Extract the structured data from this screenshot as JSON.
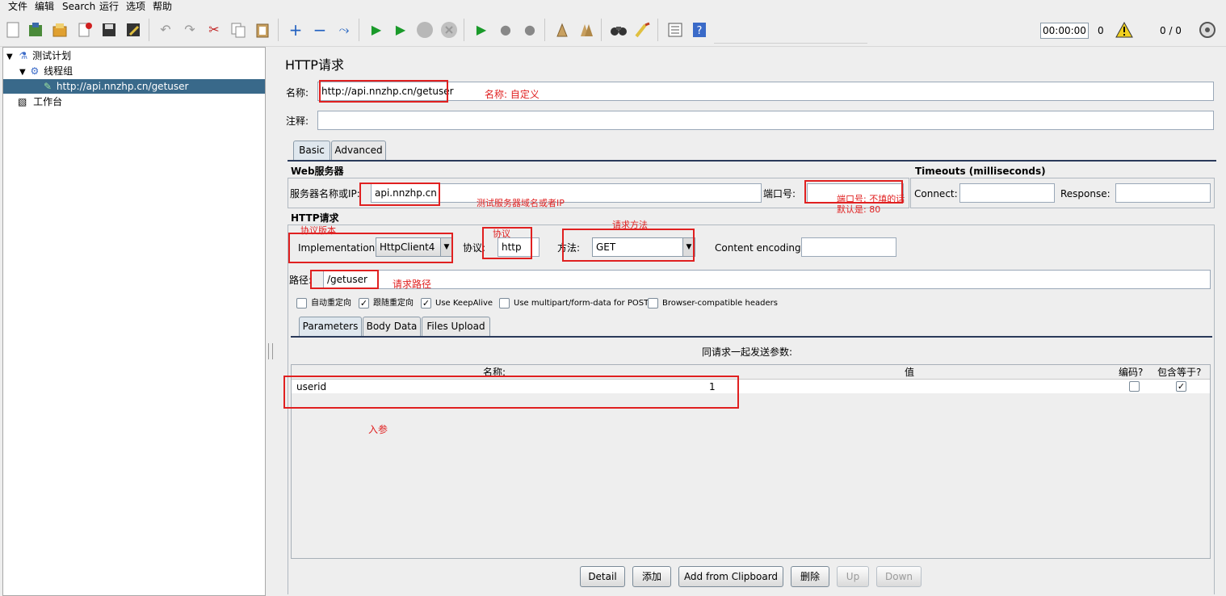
{
  "menu": [
    "文件",
    "编辑",
    "Search",
    "运行",
    "选项",
    "帮助"
  ],
  "toolbar": {
    "timer": "00:00:00",
    "active_threads": "0",
    "ratio": "0 / 0"
  },
  "tree": {
    "items": [
      {
        "label": "测试计划"
      },
      {
        "label": "线程组"
      },
      {
        "label": "http://api.nnzhp.cn/getuser"
      },
      {
        "label": "工作台"
      }
    ]
  },
  "sampler": {
    "title": "HTTP请求",
    "name_label": "名称:",
    "name_value": "http://api.nnzhp.cn/getuser",
    "comment_label": "注释:",
    "comment_value": "",
    "tabs": [
      "Basic",
      "Advanced"
    ],
    "web_server_title": "Web服务器",
    "server_label": "服务器名称或IP:",
    "server_value": "api.nnzhp.cn",
    "port_label": "端口号:",
    "port_value": "",
    "timeouts_title": "Timeouts (milliseconds)",
    "connect_label": "Connect:",
    "response_label": "Response:",
    "http_request_title": "HTTP请求",
    "impl_label": "Implementation:",
    "impl_value": "HttpClient4",
    "protocol_label": "协议:",
    "protocol_value": "http",
    "method_label": "方法:",
    "method_value": "GET",
    "encoding_label": "Content encoding:",
    "encoding_value": "",
    "path_label": "路径:",
    "path_value": "/getuser",
    "checkboxes": [
      {
        "label": "自动重定向",
        "checked": false
      },
      {
        "label": "跟随重定向",
        "checked": true
      },
      {
        "label": "Use KeepAlive",
        "checked": true
      },
      {
        "label": "Use multipart/form-data for POST",
        "checked": false
      },
      {
        "label": "Browser-compatible headers",
        "checked": false
      }
    ],
    "param_tabs": [
      "Parameters",
      "Body Data",
      "Files Upload"
    ],
    "params_caption": "同请求一起发送参数:",
    "table_headers": [
      "名称:",
      "值",
      "编码?",
      "包含等于?"
    ],
    "rows": [
      {
        "name": "userid",
        "value": "1",
        "encode": false,
        "include_equals": true
      }
    ],
    "buttons": [
      {
        "label": "Detail",
        "enabled": true
      },
      {
        "label": "添加",
        "enabled": true
      },
      {
        "label": "Add from Clipboard",
        "enabled": true
      },
      {
        "label": "删除",
        "enabled": true
      },
      {
        "label": "Up",
        "enabled": false
      },
      {
        "label": "Down",
        "enabled": false
      }
    ]
  },
  "annotations": {
    "name_note": "名称: 自定义",
    "server_note": "测试服务器域名或者IP",
    "port_note_1": "端口号: 不填的话",
    "port_note_2": "默认是: 80",
    "method_note": "请求方法",
    "impl_note": "协议版本",
    "protocol_note": "协议",
    "path_note": "请求路径",
    "params_note": "入参"
  },
  "colors": {
    "annotation_red": "#e02020",
    "tree_selection": "#39698a"
  }
}
